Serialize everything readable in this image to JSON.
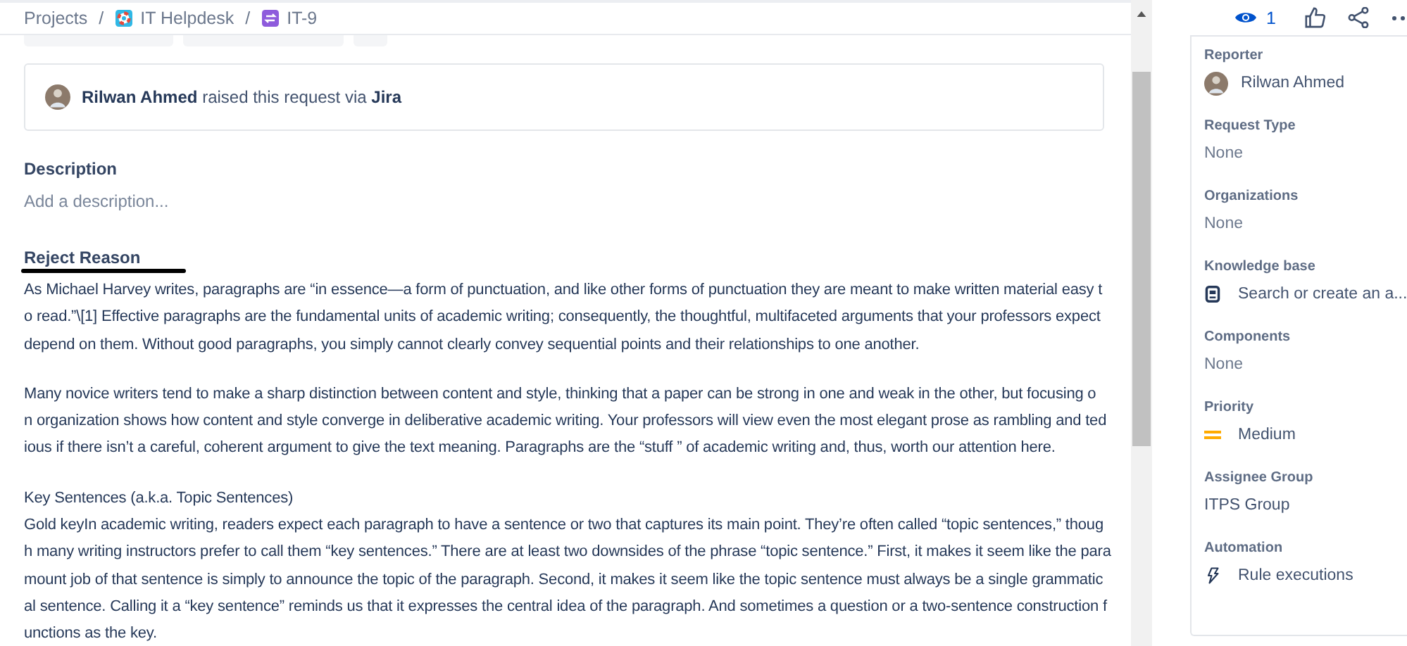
{
  "breadcrumbs": [
    {
      "label": "Projects"
    },
    {
      "separator": "/",
      "label": "IT Helpdesk"
    },
    {
      "separator": "/",
      "label": "IT-9"
    }
  ],
  "raised": {
    "name": "Rilwan Ahmed",
    "text": "raised this request via",
    "channel": "Jira"
  },
  "description": {
    "label": "Description",
    "placeholder": "Add a description..."
  },
  "reject_reason": {
    "label": "Reject Reason",
    "paragraphs": [
      [
        "As Michael Harvey writes, paragraphs are “in essence—a form of punctuation, and like other forms of punctuation they are meant to make written material easy t",
        "o read.”\\[1] Effective paragraphs are the fundamental units of academic writing; consequently, the thoughtful, multifaceted arguments that your professors expect",
        "depend on them. Without good paragraphs, you simply cannot clearly convey sequential points and their relationships to one another."
      ],
      [
        "Many novice writers tend to make a sharp distinction between content and style, thinking that a paper can be strong in one and weak in the other, but focusing o",
        "n organization shows how content and style converge in deliberative academic writing. Your professors will view even the most elegant prose as rambling and ted",
        "ious if there isn’t a careful, coherent argument to give the text meaning. Paragraphs are the “stuff ” of academic writing and, thus, worth our attention here."
      ],
      [
        "Key Sentences (a.k.a. Topic Sentences)",
        "Gold keyIn academic writing, readers expect each paragraph to have a sentence or two that captures its main point. They’re often called “topic sentences,” thoug",
        "h many writing instructors prefer to call them “key sentences.” There are at least two downsides of the phrase “topic sentence.” First, it makes it seem like the para",
        "mount job of that sentence is simply to announce the topic of the paragraph. Second, it makes it seem like the topic sentence must always be a single grammatic",
        "al sentence. Calling it a “key sentence” reminds us that it expresses the central idea of the paragraph. And sometimes a question or a two-sentence construction f",
        "unctions as the key."
      ]
    ]
  },
  "actions": {
    "watchers": "1"
  },
  "details": [
    {
      "label": "Reporter",
      "value": "Rilwan Ahmed",
      "kind": "user"
    },
    {
      "label": "Request Type",
      "value": "None",
      "kind": "empty"
    },
    {
      "label": "Organizations",
      "value": "None",
      "kind": "empty"
    },
    {
      "label": "Knowledge base",
      "value": "Search or create an a...",
      "kind": "article"
    },
    {
      "label": "Components",
      "value": "None",
      "kind": "empty"
    },
    {
      "label": "Priority",
      "value": "Medium",
      "kind": "priority"
    },
    {
      "label": "Assignee Group",
      "value": "ITPS Group",
      "kind": "text"
    },
    {
      "label": "Automation",
      "value": "Rule executions",
      "kind": "automation"
    }
  ]
}
